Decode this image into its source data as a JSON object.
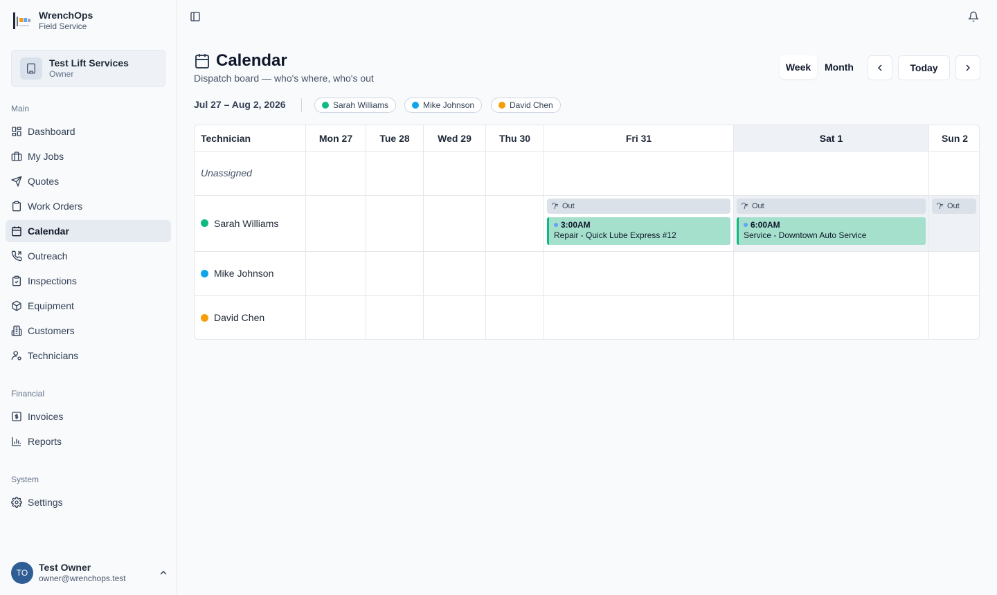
{
  "brand": {
    "title": "WrenchOps",
    "subtitle": "Field Service"
  },
  "org": {
    "name": "Test Lift Services",
    "role": "Owner"
  },
  "nav": {
    "main_label": "Main",
    "main": [
      {
        "label": "Dashboard",
        "icon": "dashboard-icon"
      },
      {
        "label": "My Jobs",
        "icon": "briefcase-icon"
      },
      {
        "label": "Quotes",
        "icon": "send-icon"
      },
      {
        "label": "Work Orders",
        "icon": "clipboard-icon"
      },
      {
        "label": "Calendar",
        "icon": "calendar-icon",
        "active": true
      },
      {
        "label": "Outreach",
        "icon": "phone-icon"
      },
      {
        "label": "Inspections",
        "icon": "clipboard-check-icon"
      },
      {
        "label": "Equipment",
        "icon": "package-icon"
      },
      {
        "label": "Customers",
        "icon": "building-icon"
      },
      {
        "label": "Technicians",
        "icon": "user-cog-icon"
      }
    ],
    "financial_label": "Financial",
    "financial": [
      {
        "label": "Invoices",
        "icon": "receipt-icon"
      },
      {
        "label": "Reports",
        "icon": "bar-chart-icon"
      }
    ],
    "system_label": "System",
    "system": [
      {
        "label": "Settings",
        "icon": "gear-icon"
      }
    ]
  },
  "user": {
    "initials": "TO",
    "name": "Test Owner",
    "email": "owner@wrenchops.test"
  },
  "page": {
    "title": "Calendar",
    "subtitle": "Dispatch board — who's where, who's out",
    "views": {
      "week": "Week",
      "month": "Month",
      "active": "Week"
    },
    "today_label": "Today",
    "range": "Jul 27 – Aug 2, 2026"
  },
  "technicians": [
    {
      "name": "Sarah Williams",
      "color": "#10b981"
    },
    {
      "name": "Mike Johnson",
      "color": "#0ea5e9"
    },
    {
      "name": "David Chen",
      "color": "#f59e0b"
    }
  ],
  "board": {
    "tech_header": "Technician",
    "days": [
      "Mon 27",
      "Tue 28",
      "Wed 29",
      "Thu 30",
      "Fri 31",
      "Sat 1",
      "Sun 2"
    ],
    "today": "Sat 1",
    "unassigned_label": "Unassigned",
    "out_label": "Out",
    "jobs": [
      {
        "time": "3:00AM",
        "title": "Repair - Quick Lube Express #12"
      },
      {
        "time": "6:00AM",
        "title": "Service - Downtown Auto Service"
      }
    ]
  },
  "colors": {
    "accent": "#10b981",
    "job_bg": "#a5e0cc",
    "out_bg": "#dbe1e8",
    "today_col": "#eef2f6"
  }
}
